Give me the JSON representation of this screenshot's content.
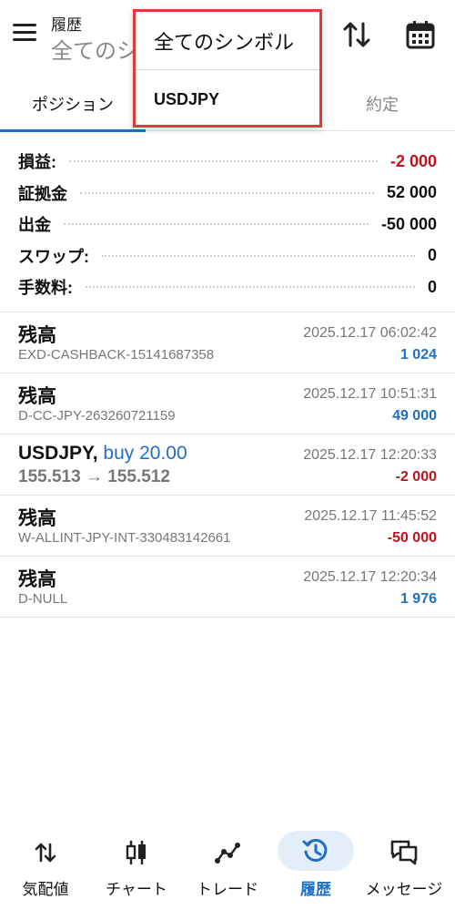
{
  "header": {
    "title": "履歴",
    "subtitle": "全てのシ"
  },
  "tabs": {
    "positions": "ポジション",
    "deals": "約定"
  },
  "dropdown": {
    "options": [
      "全てのシンボル",
      "USDJPY"
    ]
  },
  "summary": [
    {
      "label": "損益:",
      "value": "-2 000",
      "color": "#c1121f"
    },
    {
      "label": "証拠金",
      "value": "52 000",
      "color": "#111111"
    },
    {
      "label": "出金",
      "value": "-50 000",
      "color": "#111111"
    },
    {
      "label": "スワップ:",
      "value": "0",
      "color": "#111111"
    },
    {
      "label": "手数料:",
      "value": "0",
      "color": "#111111"
    }
  ],
  "rows": [
    {
      "title": "残高",
      "sub": "EXD-CASHBACK-15141687358",
      "time": "2025.12.17 06:02:42",
      "amount": "1 024",
      "amount_color": "#1f6fc2"
    },
    {
      "title": "残高",
      "sub": "D-CC-JPY-263260721159",
      "time": "2025.12.17 10:51:31",
      "amount": "49 000",
      "amount_color": "#1f6fc2"
    },
    {
      "title": "USDJPY,",
      "title_extra": "buy 20.00",
      "sub": "155.513 → 155.512",
      "time": "2025.12.17 12:20:33",
      "amount": "-2 000",
      "amount_color": "#c1121f"
    },
    {
      "title": "残高",
      "sub": "W-ALLINT-JPY-INT-330483142661",
      "time": "2025.12.17 11:45:52",
      "amount": "-50 000",
      "amount_color": "#c1121f"
    },
    {
      "title": "残高",
      "sub": "D-NULL",
      "time": "2025.12.17 12:20:34",
      "amount": "1 976",
      "amount_color": "#1f6fc2"
    }
  ],
  "bottom_nav": [
    {
      "label": "気配値",
      "icon": "quotes-icon"
    },
    {
      "label": "チャート",
      "icon": "chart-icon"
    },
    {
      "label": "トレード",
      "icon": "trade-icon"
    },
    {
      "label": "履歴",
      "icon": "history-icon",
      "active": true
    },
    {
      "label": "メッセージ",
      "icon": "messages-icon"
    }
  ],
  "colors": {
    "accent": "#1f6fc2",
    "negative": "#c1121f",
    "highlight_border": "#e03a3a"
  }
}
